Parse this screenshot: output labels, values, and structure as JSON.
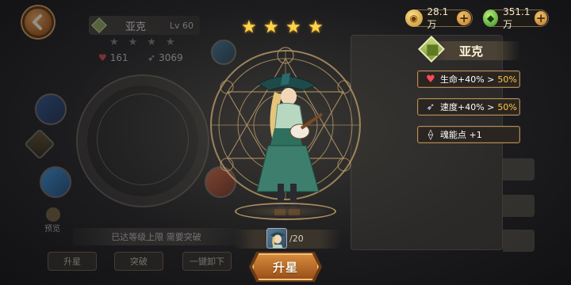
{
  "currency": {
    "gold": {
      "value": "28.1万",
      "icon": "gold-coin-icon"
    },
    "gems": {
      "value": "351.1万",
      "icon": "green-gem-icon"
    }
  },
  "background": {
    "hero_name": "亚克",
    "hero_level": "Lv 60",
    "stat_hp": "161",
    "stat_speed": "3069",
    "preview_label": "预览",
    "banner_text": "已达等级上限 需要突破",
    "buttons": {
      "star_up": "升星",
      "breakthrough": "突破",
      "one_key": "一键卸下"
    }
  },
  "popup": {
    "stars": 4,
    "hero_name": "亚克",
    "bonuses": [
      {
        "icon": "heart-icon",
        "label": "生命+40% > ",
        "highlight": "50%"
      },
      {
        "icon": "wing-boot-icon",
        "label": "速度+40% > ",
        "highlight": "50%"
      },
      {
        "icon": "soul-crystal-icon",
        "label": "魂能点 +1",
        "highlight": ""
      }
    ],
    "requirement_count": "/20",
    "upgrade_label": "升星"
  },
  "colors": {
    "accent_gold": "#ffc846",
    "button_orange": "#c57a30",
    "star_yellow": "#ffd34a"
  }
}
